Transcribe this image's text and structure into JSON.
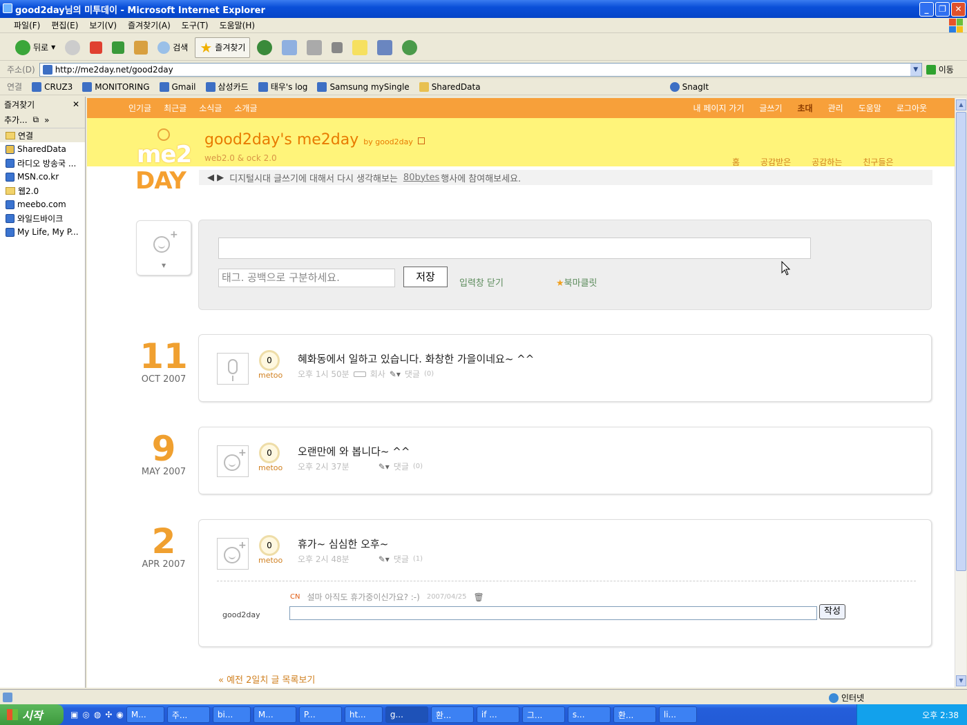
{
  "window": {
    "title": "good2day님의 미투데이 - Microsoft Internet Explorer"
  },
  "menu": [
    "파일(F)",
    "편집(E)",
    "보기(V)",
    "즐겨찾기(A)",
    "도구(T)",
    "도움말(H)"
  ],
  "toolbar": {
    "back": "뒤로",
    "search": "검색",
    "favorites": "즐겨찾기"
  },
  "address": {
    "label": "주소(D)",
    "url": "http://me2day.net/good2day",
    "go": "이동"
  },
  "links": {
    "label": "연결",
    "items": [
      "CRUZ3",
      "MONITORING",
      "Gmail",
      "삼성카드",
      "태우's log",
      "Samsung mySingle",
      "SharedData"
    ],
    "snagit": "SnagIt"
  },
  "favorites": {
    "title": "즐겨찾기",
    "add": "추가...",
    "items": [
      {
        "label": "연결",
        "icon": "folder-icon"
      },
      {
        "label": "SharedData",
        "icon": "page-icon"
      },
      {
        "label": "라디오 방송국 ...",
        "icon": "page-icon"
      },
      {
        "label": "MSN.co.kr",
        "icon": "page-icon"
      },
      {
        "label": "웹2.0",
        "icon": "folder-icon"
      },
      {
        "label": "meebo.com",
        "icon": "page-icon"
      },
      {
        "label": "와일드바이크",
        "icon": "page-icon"
      },
      {
        "label": "My Life, My P...",
        "icon": "page-icon"
      }
    ]
  },
  "site": {
    "topnav_left": [
      "인기글",
      "최근글",
      "소식글",
      "소개글"
    ],
    "topnav_right": [
      "내 페이지 가기",
      "글쓰기",
      "초대",
      "관리",
      "도움말",
      "로그아웃"
    ],
    "logo_top": "me2",
    "logo_bottom": "DAY",
    "title": "good2day's me2day",
    "by": "by good2day",
    "subtitle": "web2.0 & ock 2.0",
    "subnav": [
      "홈",
      "공감받은",
      "공감하는",
      "친구들은"
    ],
    "notice_pre": "디지털시대 글쓰기에 대해서 다시 생각해보는",
    "notice_link": "80bytes",
    "notice_post": "행사에 참여해보세요."
  },
  "compose": {
    "tag_placeholder": "태그. 공백으로 구분하세요.",
    "save": "저장",
    "close": "입력창 닫기",
    "bookmarklet": "북마클릿"
  },
  "posts": [
    {
      "day": "11",
      "month": "OCT 2007",
      "text": "혜화동에서 일하고 있습니다. 화창한 가을이네요~ ^^",
      "time": "오후 1시 50분",
      "location": "회사",
      "comments": "댓글",
      "count": "(0)",
      "metoo": "0",
      "metoo_label": "metoo"
    },
    {
      "day": "9",
      "month": "MAY 2007",
      "text": "오랜만에 와 봅니다~ ^^",
      "time": "오후 2시 37분",
      "comments": "댓글",
      "count": "(0)",
      "metoo": "0",
      "metoo_label": "metoo"
    },
    {
      "day": "2",
      "month": "APR 2007",
      "text": "휴가~ 심심한 오후~",
      "time": "오후 2시 48분",
      "comments": "댓글",
      "count": "(1)",
      "metoo": "0",
      "metoo_label": "metoo"
    }
  ],
  "comment": {
    "author_tag": "CN",
    "text": "설마 아직도 휴가중이신가요? :-)",
    "date": "2007/04/25",
    "commenter": "good2day",
    "submit": "작성"
  },
  "more": "« 예전 2일치 글 목록보기",
  "status": {
    "zone": "인터넷"
  },
  "taskbar": {
    "start": "시작",
    "items": [
      "M...",
      "주...",
      "bi...",
      "M...",
      "P...",
      "ht...",
      "g...",
      "환...",
      "if ...",
      "그...",
      "s...",
      "환...",
      "li..."
    ],
    "time": "오후 2:38"
  }
}
